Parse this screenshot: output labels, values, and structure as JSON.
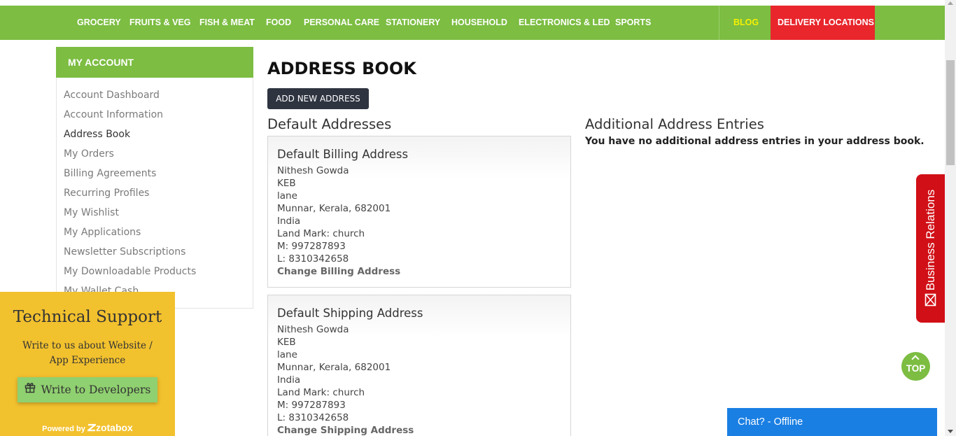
{
  "nav": {
    "items": [
      "GROCERY",
      "FRUITS & VEG",
      "FISH & MEAT",
      "FOOD",
      "PERSONAL CARE",
      "STATIONERY",
      "HOUSEHOLD",
      "ELECTRONICS & LED",
      "SPORTS"
    ],
    "blog": "BLOG",
    "delivery": "DELIVERY LOCATIONS",
    "colors": {
      "bar": "#7cbd42",
      "blog_text": "#f6f000",
      "delivery_bg": "#e8262c"
    }
  },
  "sidebar": {
    "title": "MY ACCOUNT",
    "items": [
      {
        "label": "Account Dashboard",
        "active": false
      },
      {
        "label": "Account Information",
        "active": false
      },
      {
        "label": "Address Book",
        "active": true
      },
      {
        "label": "My Orders",
        "active": false
      },
      {
        "label": "Billing Agreements",
        "active": false
      },
      {
        "label": "Recurring Profiles",
        "active": false
      },
      {
        "label": "My Wishlist",
        "active": false
      },
      {
        "label": "My Applications",
        "active": false
      },
      {
        "label": "Newsletter Subscriptions",
        "active": false
      },
      {
        "label": "My Downloadable Products",
        "active": false
      },
      {
        "label": "My Wallet Cash",
        "active": false
      }
    ]
  },
  "main": {
    "title": "ADDRESS BOOK",
    "add_button": "ADD NEW ADDRESS",
    "default_heading": "Default Addresses",
    "additional_heading": "Additional Address Entries",
    "additional_empty": "You have no additional address entries in your address book.",
    "billing": {
      "heading": "Default Billing Address",
      "lines": [
        "Nithesh Gowda",
        "KEB",
        "lane",
        "Munnar, Kerala, 682001",
        "India",
        "Land Mark: church",
        "M: 997287893",
        "L: 8310342658"
      ],
      "link": "Change Billing Address"
    },
    "shipping": {
      "heading": "Default Shipping Address",
      "lines": [
        "Nithesh Gowda",
        "KEB",
        "lane",
        "Munnar, Kerala, 682001",
        "India",
        "Land Mark: church",
        "M: 997287893",
        "L: 8310342658"
      ],
      "link": "Change Shipping Address"
    }
  },
  "support": {
    "title": "Technical Support",
    "subtitle": "Write to us about Website / App Experience",
    "button": "Write to Developers",
    "powered_prefix": "Powered by",
    "powered_brand": "zotabox",
    "icon": "gift-icon",
    "color": "#f2c12e"
  },
  "business": {
    "label": "Business Relations",
    "icon": "mail-icon",
    "color": "#d10f16"
  },
  "top_button": {
    "label": "TOP",
    "icon": "chevron-up-icon"
  },
  "chat": {
    "label": "Chat? - Offline",
    "color": "#1a7fe3"
  }
}
